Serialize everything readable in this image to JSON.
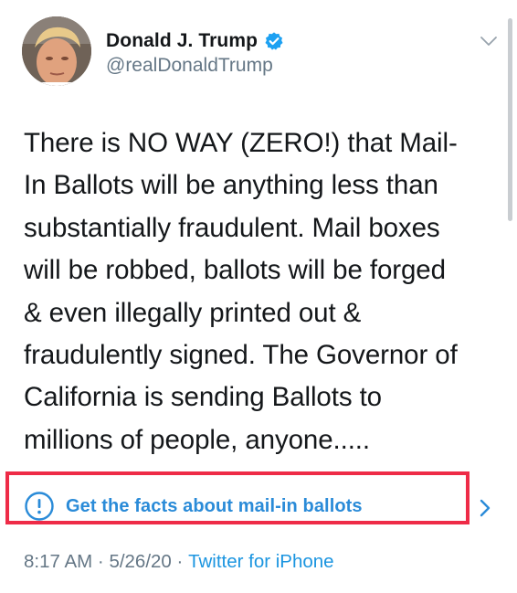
{
  "user": {
    "display_name": "Donald J. Trump",
    "handle": "@realDonaldTrump",
    "verified": true
  },
  "tweet": {
    "text_lines": [
      "There is NO WAY (ZERO!) that Mail-",
      "In Ballots will be anything less than",
      "substantially fraudulent. Mail boxes",
      "will be robbed, ballots will be forged",
      "& even illegally printed out &",
      "fraudulently signed. The Governor of",
      "California is sending Ballots to",
      "millions of people, anyone....."
    ]
  },
  "notice": {
    "label": "Get the facts about mail-in ballots"
  },
  "meta": {
    "time": "8:17 AM",
    "separator": " · ",
    "date": "5/26/20",
    "source": "Twitter for iPhone"
  },
  "colors": {
    "link_blue": "#1b95e0",
    "highlight_red": "#ee2b47",
    "secondary_text": "#657786"
  },
  "icons": [
    "avatar",
    "verified-icon",
    "chevron-down-icon",
    "info-icon",
    "chevron-right-icon"
  ]
}
